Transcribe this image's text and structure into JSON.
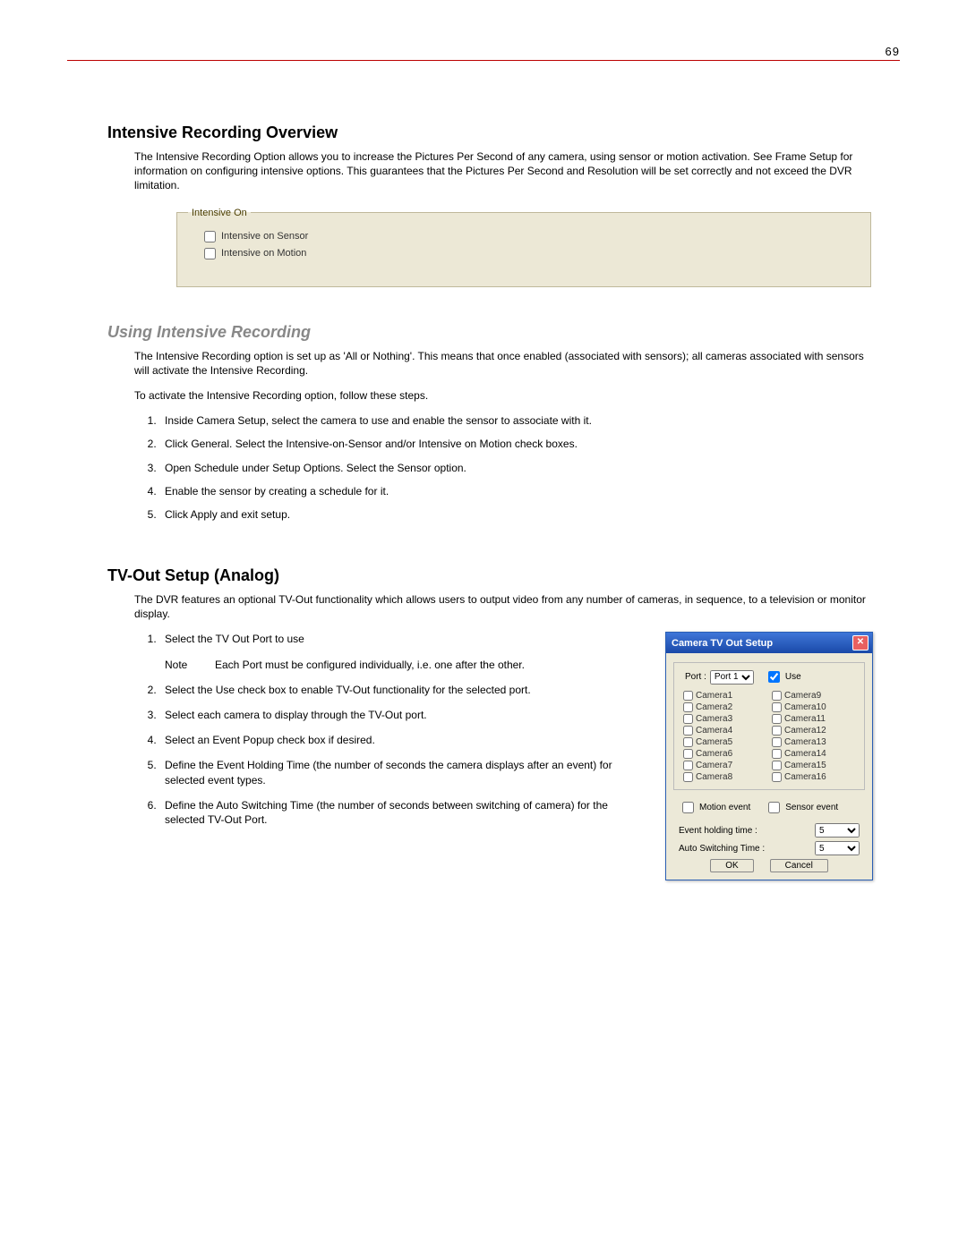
{
  "page_number": "69",
  "section1": {
    "heading": "Intensive Recording Overview",
    "para": "The Intensive Recording Option allows you to increase the Pictures Per Second of any camera, using sensor or motion activation. See Frame Setup for information on configuring intensive options. This guarantees that the Pictures Per Second and Resolution will be set correctly and not exceed the DVR limitation."
  },
  "intensive_panel": {
    "legend": "Intensive On",
    "opt_sensor": "Intensive on Sensor",
    "opt_motion": "Intensive on Motion"
  },
  "section2": {
    "heading": "Using Intensive Recording",
    "para1": "The Intensive Recording option is set up as 'All or Nothing'. This means that once enabled (associated with sensors); all cameras associated with sensors will activate the Intensive Recording.",
    "para2": "To activate the Intensive Recording option, follow these steps.",
    "steps": [
      "Inside Camera Setup, select the camera to use and enable the sensor to associate with it.",
      "Click General. Select the Intensive-on-Sensor and/or Intensive on Motion check boxes.",
      "Open Schedule under Setup Options. Select the Sensor option.",
      "Enable the sensor by creating a schedule for it.",
      "Click Apply and exit setup."
    ]
  },
  "section3": {
    "heading": "TV-Out Setup (Analog)",
    "para": "The DVR features an optional TV-Out functionality which allows users to output video from any number of cameras, in sequence, to a television or monitor display.",
    "step1": "Select the TV Out Port to use",
    "note_label": "Note",
    "note_text": "Each Port must be configured individually, i.e. one after the other.",
    "step2": "Select the Use check box to enable TV-Out functionality for the selected port.",
    "step3": "Select each camera to display through the TV-Out port.",
    "step4": "Select an Event Popup check box if desired.",
    "step5": "Define the Event Holding Time (the number of seconds the camera displays after an event) for selected event types.",
    "step6": "Define the Auto Switching Time (the number of seconds between switching of camera) for the selected TV-Out Port."
  },
  "dialog": {
    "title": "Camera TV Out Setup",
    "port_label": "Port :",
    "port_value": "Port 1",
    "use_label": "Use",
    "cameras_left": [
      "Camera1",
      "Camera2",
      "Camera3",
      "Camera4",
      "Camera5",
      "Camera6",
      "Camera7",
      "Camera8"
    ],
    "cameras_right": [
      "Camera9",
      "Camera10",
      "Camera11",
      "Camera12",
      "Camera13",
      "Camera14",
      "Camera15",
      "Camera16"
    ],
    "motion_event": "Motion event",
    "sensor_event": "Sensor event",
    "holding_label": "Event holding time :",
    "holding_value": "5",
    "switching_label": "Auto Switching Time :",
    "switching_value": "5",
    "ok": "OK",
    "cancel": "Cancel"
  }
}
